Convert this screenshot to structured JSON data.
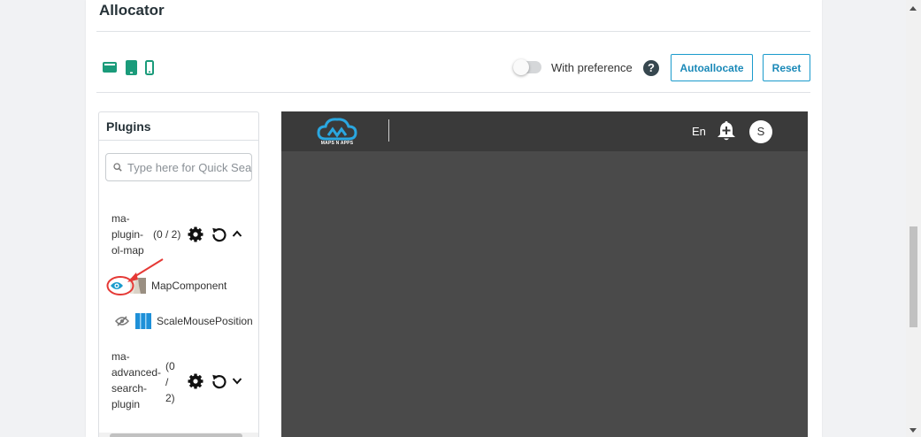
{
  "allocator": {
    "title": "Allocator",
    "devices": [
      {
        "name": "desktop",
        "icon": "desktop-icon"
      },
      {
        "name": "tablet",
        "icon": "tablet-icon"
      },
      {
        "name": "mobile",
        "icon": "mobile-icon"
      }
    ],
    "preference_label": "With preference",
    "autoallocate_label": "Autoallocate",
    "reset_label": "Reset",
    "accent_color": "#1a9b7a",
    "button_color": "#1a9bcc"
  },
  "plugins": {
    "header": "Plugins",
    "search_placeholder": "Type here for Quick Search",
    "groups": [
      {
        "name": "ma-plugin-ol-map",
        "count": "(0 / 2)",
        "items": [
          {
            "label": "MapComponent",
            "visible": true
          },
          {
            "label": "ScaleMousePosition",
            "visible": false
          }
        ]
      },
      {
        "name": "ma-advanced-search-plugin",
        "count": "(0 / 2)"
      }
    ]
  },
  "preview": {
    "logo_text": "MAPS N APPS",
    "language": "En",
    "avatar_initial": "S",
    "bar_color": "#3a3a3a",
    "canvas_color": "#4a4a4a"
  }
}
